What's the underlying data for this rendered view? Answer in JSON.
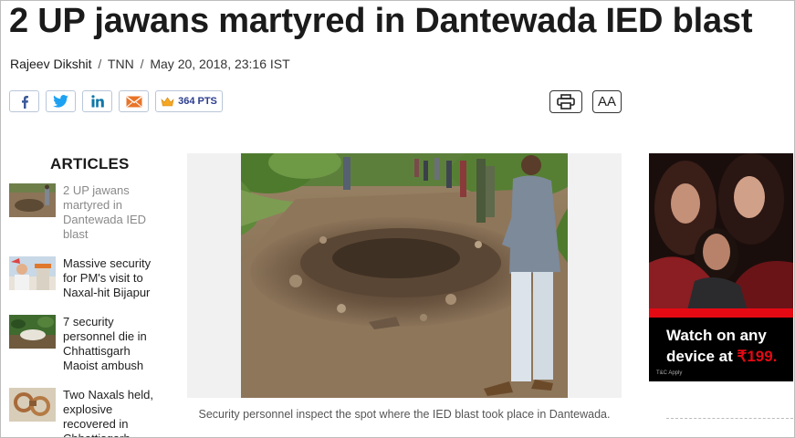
{
  "article": {
    "headline": "2 UP jawans martyred in Dantewada IED blast",
    "author": "Rajeev Dikshit",
    "source": "TNN",
    "date": "May 20, 2018, 23:16 IST",
    "separator": "/"
  },
  "share": {
    "facebook_icon": "facebook-icon",
    "twitter_icon": "twitter-icon",
    "linkedin_icon": "linkedin-icon",
    "email_icon": "email-icon",
    "points_label": "364 PTS",
    "colors": {
      "facebook": "#3b5998",
      "twitter": "#1da1f2",
      "linkedin": "#0e76a8",
      "email": "#e8742a",
      "points": "#2c3d8f"
    }
  },
  "tools": {
    "print_icon": "printer-icon",
    "font_size_label": "AA"
  },
  "sidebar": {
    "title": "ARTICLES",
    "items": [
      {
        "title": "2 UP jawans martyred in Dantewada IED blast",
        "active": true
      },
      {
        "title": "Massive security for PM's visit to Naxal-hit Bijapur",
        "active": false
      },
      {
        "title": "7 security personnel die in Chhattisgarh Maoist ambush",
        "active": false
      },
      {
        "title": "Two Naxals held, explosive recovered in Chhattisgarh",
        "active": false
      }
    ]
  },
  "main": {
    "caption": "Security personnel inspect the spot where the IED blast took place in Dantewada."
  },
  "ad": {
    "line1": "Watch on any",
    "line2_prefix": "device at ",
    "price": "₹199.",
    "tc": "T&C Apply"
  }
}
